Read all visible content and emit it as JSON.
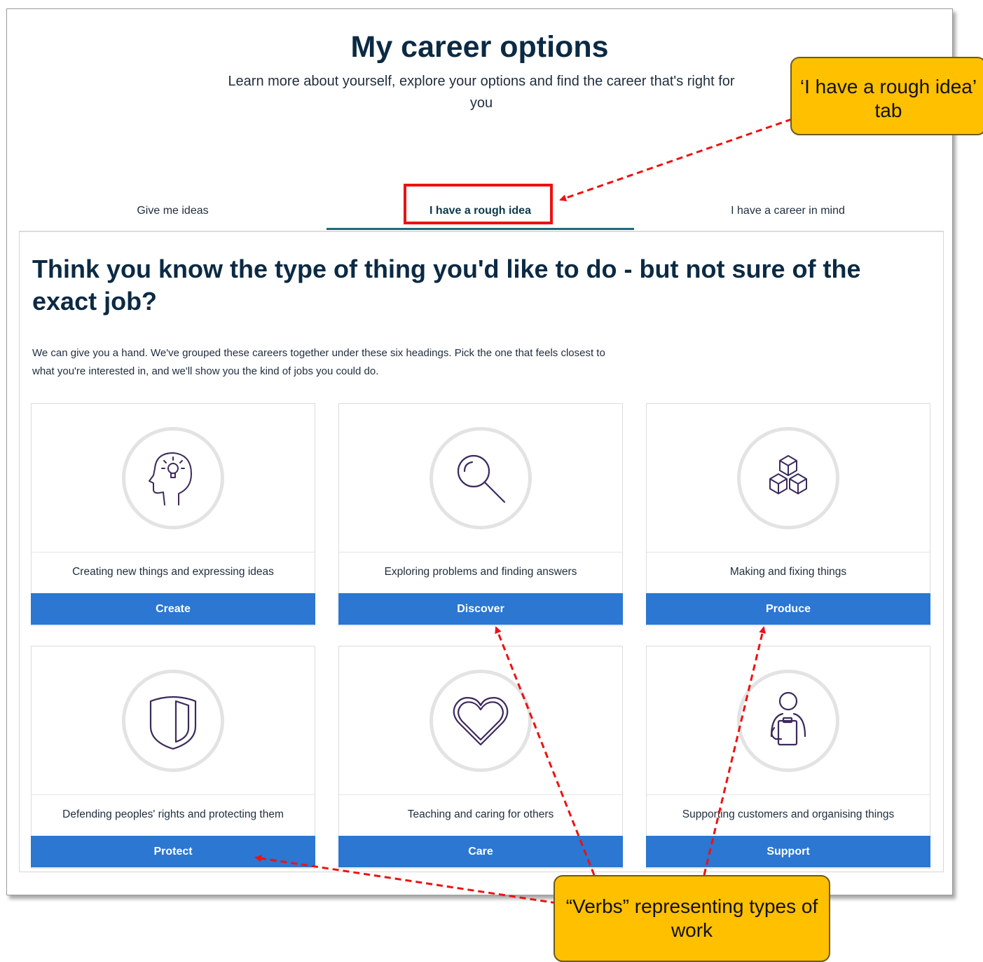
{
  "header": {
    "title": "My career options",
    "subtitle": "Learn more about yourself, explore your options and find the career that's right for you"
  },
  "tabs": [
    {
      "label": "Give me ideas",
      "active": false
    },
    {
      "label": "I have a rough idea",
      "active": true
    },
    {
      "label": "I have a career in mind",
      "active": false
    }
  ],
  "panel": {
    "heading": "Think you know the type of thing you'd like to do - but not sure of the exact job?",
    "intro": "We can give you a hand. We've grouped these careers together under these six headings. Pick the one that feels closest to what you're interested in, and we'll show you the kind of jobs you could do."
  },
  "cards": [
    {
      "icon": "head-lightbulb-icon",
      "description": "Creating new things and expressing ideas",
      "button": "Create"
    },
    {
      "icon": "magnifying-glass-icon",
      "description": "Exploring problems and finding answers",
      "button": "Discover"
    },
    {
      "icon": "stacked-cubes-icon",
      "description": "Making and fixing things",
      "button": "Produce"
    },
    {
      "icon": "shield-icon",
      "description": "Defending peoples' rights and protecting them",
      "button": "Protect"
    },
    {
      "icon": "heart-icon",
      "description": "Teaching and caring for others",
      "button": "Care"
    },
    {
      "icon": "person-clipboard-icon",
      "description": "Supporting customers and organising things",
      "button": "Support"
    }
  ],
  "annotations": {
    "tab_callout": "‘I have a rough idea’ tab",
    "verbs_callout": "“Verbs” representing types of work"
  },
  "colors": {
    "heading": "#0b2a44",
    "button": "#2b77d1",
    "active_tab_underline": "#1d6a7a",
    "icon_stroke": "#3d2a5c",
    "callout_fill": "#ffc000",
    "annotation_red": "#ee1111"
  }
}
